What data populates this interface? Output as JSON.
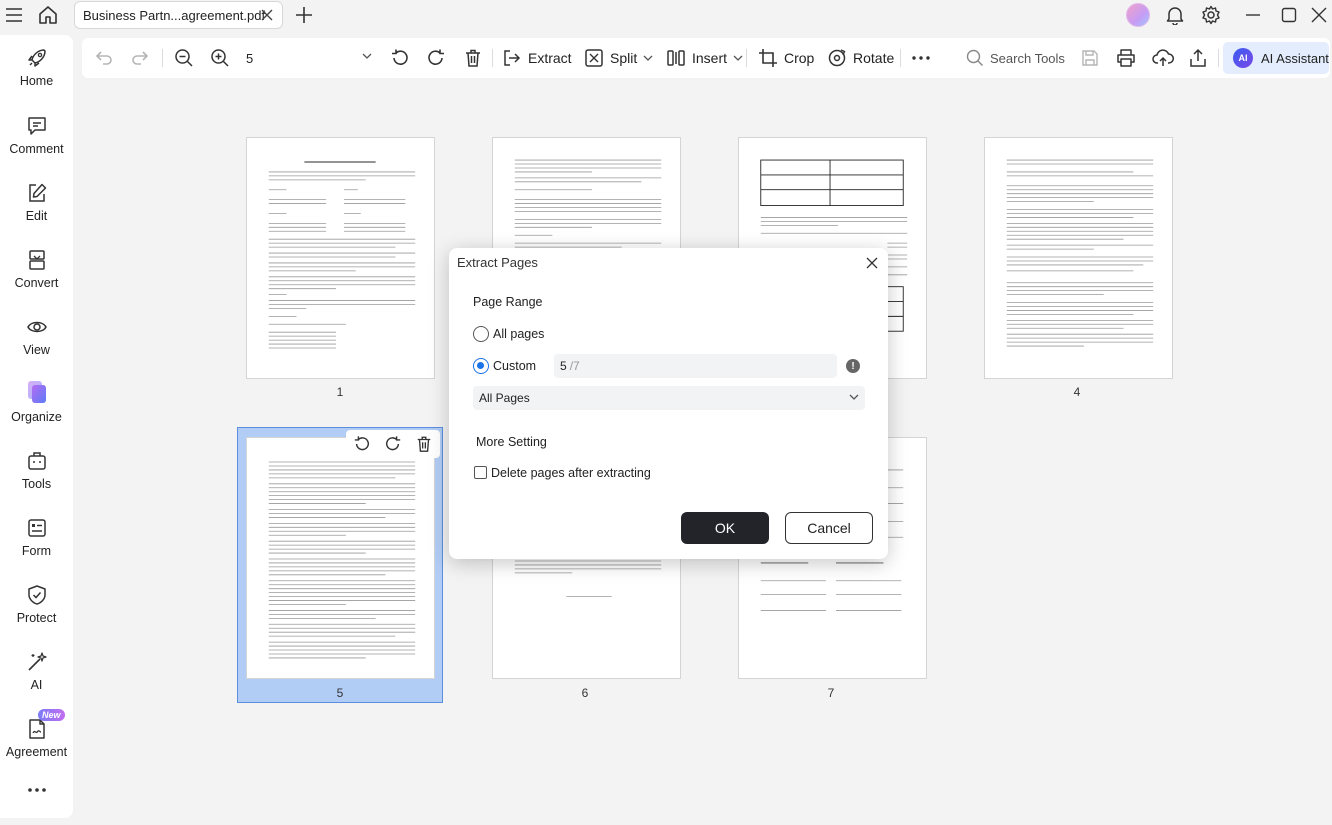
{
  "titlebar": {
    "tab_title": "Business Partn...agreement.pdf"
  },
  "sidebar": {
    "items": [
      {
        "label": "Home",
        "icon": "rocket-icon"
      },
      {
        "label": "Comment",
        "icon": "comment-icon"
      },
      {
        "label": "Edit",
        "icon": "edit-icon"
      },
      {
        "label": "Convert",
        "icon": "convert-icon"
      },
      {
        "label": "View",
        "icon": "view-icon"
      },
      {
        "label": "Organize",
        "icon": "organize-icon"
      },
      {
        "label": "Tools",
        "icon": "toolbox-icon"
      },
      {
        "label": "Form",
        "icon": "form-icon"
      },
      {
        "label": "Protect",
        "icon": "shield-icon"
      },
      {
        "label": "AI",
        "icon": "magic-wand-icon"
      },
      {
        "label": "Agreement",
        "icon": "agreement-icon",
        "badge": "New"
      }
    ]
  },
  "toolbar": {
    "page_value": "5",
    "extract_label": "Extract",
    "split_label": "Split",
    "insert_label": "Insert",
    "crop_label": "Crop",
    "rotate_label": "Rotate",
    "search_placeholder": "Search Tools",
    "ai_label": "AI Assistant",
    "ai_logo": "AI"
  },
  "pages": [
    {
      "number": "1"
    },
    {
      "number": "4"
    },
    {
      "number": "5"
    },
    {
      "number": "6"
    },
    {
      "number": "7"
    }
  ],
  "dialog": {
    "title": "Extract Pages",
    "page_range_heading": "Page Range",
    "all_pages_label": "All pages",
    "custom_label": "Custom",
    "custom_value": "5",
    "custom_total": "/7",
    "info_glyph": "!",
    "subset_selected": "All Pages",
    "more_setting_heading": "More Setting",
    "delete_after_label": "Delete pages after extracting",
    "ok_label": "OK",
    "cancel_label": "Cancel"
  },
  "colors": {
    "accent": "#1a73e8",
    "ok_button": "#22242a",
    "selection": "#b1ccf5",
    "ai_button_bg": "#e3edfd"
  }
}
